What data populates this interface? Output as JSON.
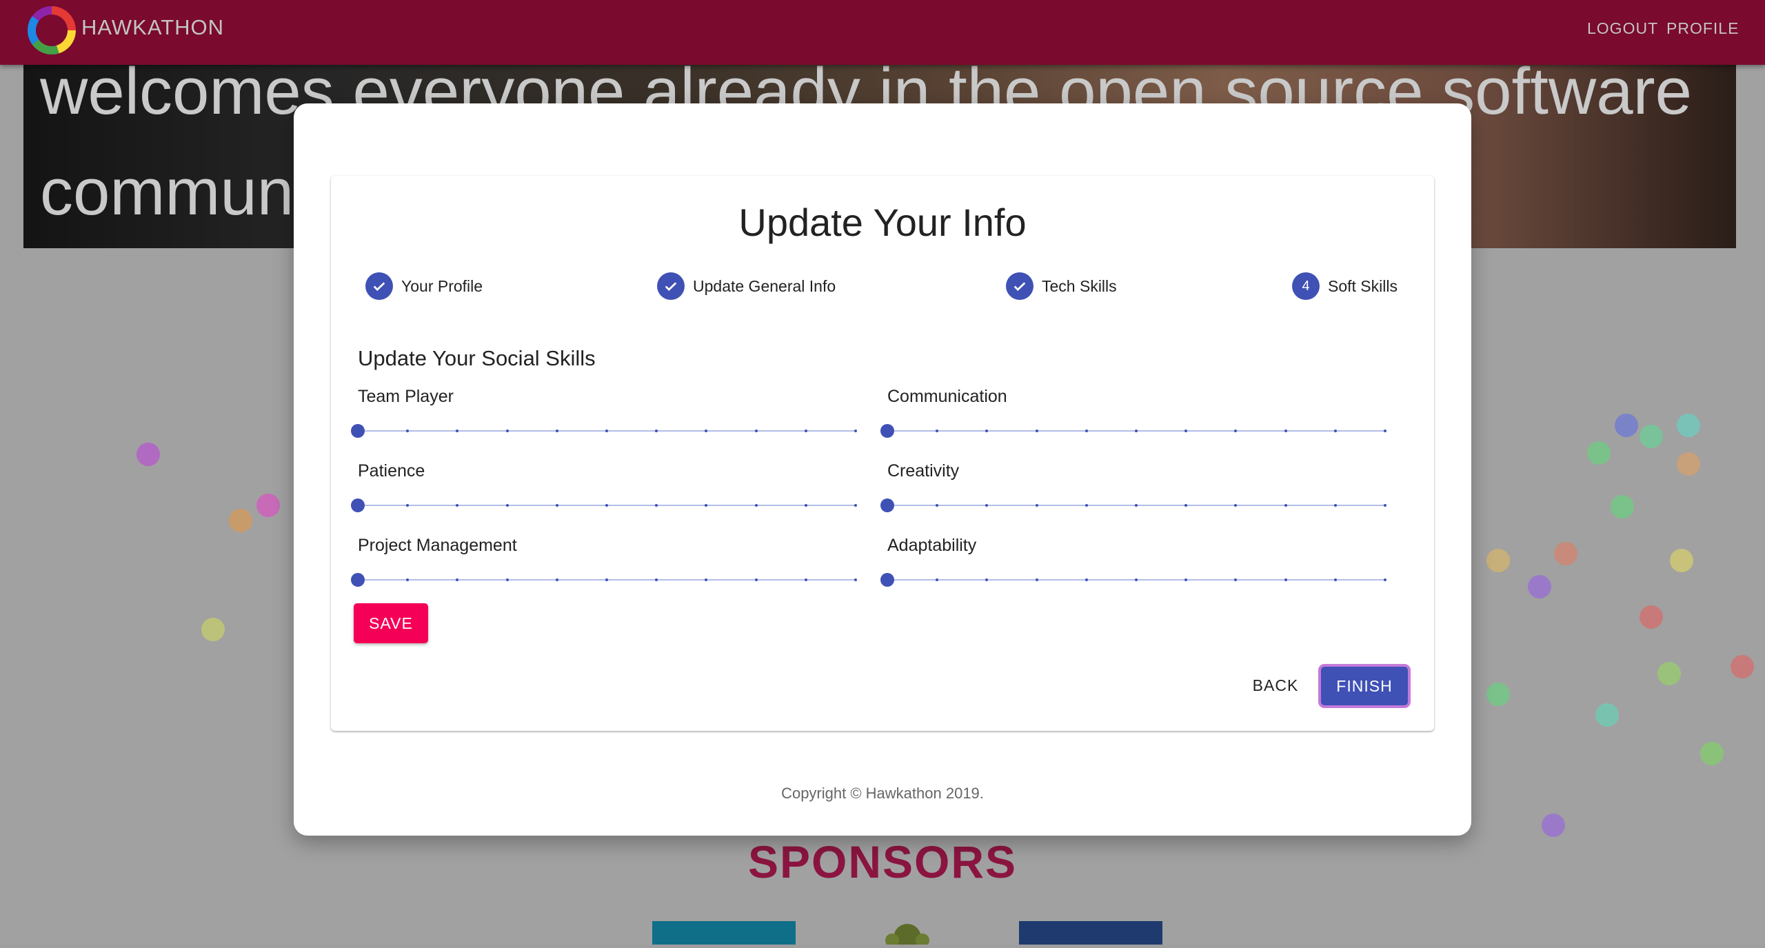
{
  "header": {
    "brand": "HAWKATHON",
    "nav": {
      "logout": "LOGOUT",
      "profile": "PROFILE"
    }
  },
  "hero": {
    "text": "welcomes everyone already in the open source software community"
  },
  "sponsors": {
    "title": "SPONSORS"
  },
  "modal": {
    "title": "Update Your Info",
    "steps": [
      {
        "label": "Your Profile",
        "status": "completed"
      },
      {
        "label": "Update General Info",
        "status": "completed"
      },
      {
        "label": "Tech Skills",
        "status": "completed"
      },
      {
        "label": "Soft Skills",
        "status": "active",
        "number": "4"
      }
    ],
    "section_title": "Update Your Social Skills",
    "skills": [
      {
        "label": "Team Player",
        "value": 0
      },
      {
        "label": "Communication",
        "value": 0
      },
      {
        "label": "Patience",
        "value": 0
      },
      {
        "label": "Creativity",
        "value": 0
      },
      {
        "label": "Project Management",
        "value": 0
      },
      {
        "label": "Adaptability",
        "value": 0
      }
    ],
    "save_label": "SAVE",
    "back_label": "BACK",
    "finish_label": "FINISH",
    "copyright": "Copyright © Hawkathon 2019."
  },
  "colors": {
    "appbar": "#7a0a2e",
    "primary": "#3f51b5",
    "accent": "#f50057",
    "sponsors": "#8b1540"
  },
  "icons": {
    "completed_step": "check-icon"
  }
}
